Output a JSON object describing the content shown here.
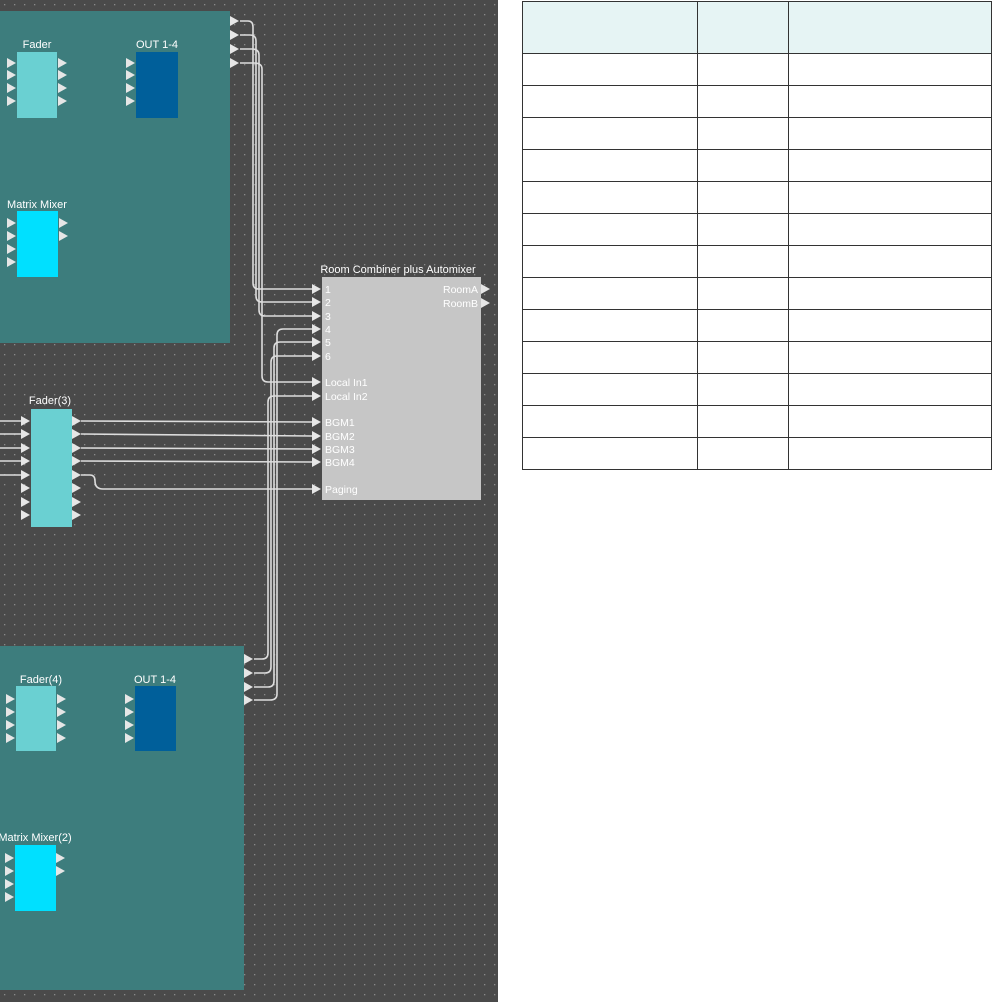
{
  "canvas": {
    "blocks": {
      "fader_top": "Fader",
      "out_top": "OUT 1-4",
      "matrix_top": "Matrix Mixer",
      "fader3": "Fader(3)",
      "fader4": "Fader(4)",
      "out_bottom": "OUT 1-4",
      "matrix_bottom": "Matrix Mixer(2)",
      "room_combiner": "Room Combiner plus Automixer"
    },
    "room_combiner_inputs": [
      "1",
      "2",
      "3",
      "4",
      "5",
      "6",
      "Local In1",
      "Local In2",
      "BGM1",
      "BGM2",
      "BGM3",
      "BGM4",
      "Paging"
    ],
    "room_combiner_outputs": [
      "RoomA",
      "RoomB"
    ],
    "colors": {
      "canvas_bg": "#4a4a4a",
      "group_bg": "#3d7d7d",
      "fader": "#6ad0d2",
      "out": "#005f9a",
      "matrix": "#00e0ff",
      "room_combiner": "#c6c6c6",
      "wire": "#dddddd"
    }
  },
  "table": {
    "headers": [
      "",
      "",
      ""
    ],
    "rows": [
      [
        "",
        "",
        ""
      ],
      [
        "",
        "",
        ""
      ],
      [
        "",
        "",
        ""
      ],
      [
        "",
        "",
        ""
      ],
      [
        "",
        "",
        ""
      ],
      [
        "",
        "",
        ""
      ],
      [
        "",
        "",
        ""
      ],
      [
        "",
        "",
        ""
      ],
      [
        "",
        "",
        ""
      ],
      [
        "",
        "",
        ""
      ],
      [
        "",
        "",
        ""
      ],
      [
        "",
        "",
        ""
      ],
      [
        "",
        "",
        ""
      ]
    ]
  }
}
